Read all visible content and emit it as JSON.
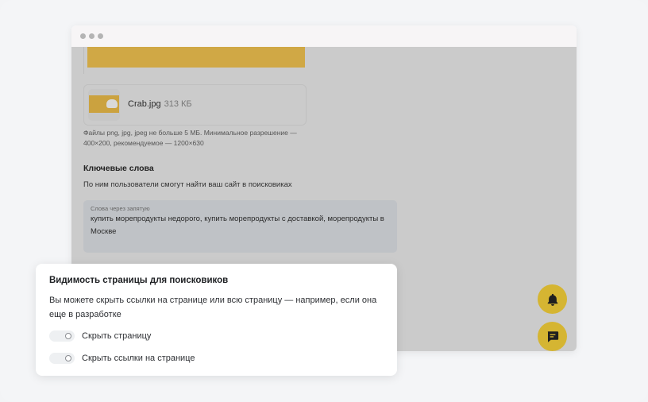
{
  "file": {
    "name": "Crab.jpg",
    "size": "313 КБ"
  },
  "upload_hint": "Файлы png, jpg, jpeg не больше 5 МБ. Минимальное разрешение — 400×200, рекомендуемое — 1200×630",
  "keywords": {
    "title": "Ключевые слова",
    "description": "По ним пользователи смогут найти ваш сайт в поисковиках",
    "placeholder": "Слова через запятую",
    "value": "купить морепродукты недорого, купить морепродукты с доставкой, морепродукты в Москве"
  },
  "visibility": {
    "title": "Видимость страницы для поисковиков",
    "description": "Вы можете скрыть ссылки на странице или всю страницу — например, если она еще в разработке",
    "toggles": [
      {
        "label": "Скрыть страницу",
        "on": false
      },
      {
        "label": "Скрыть ссылки на странице",
        "on": false
      }
    ]
  },
  "icons": {
    "notifications": "bell-icon",
    "chat": "chat-icon"
  },
  "colors": {
    "accent": "#d5b532",
    "banner": "#d0a845",
    "overlay": "#cbcbcb"
  }
}
